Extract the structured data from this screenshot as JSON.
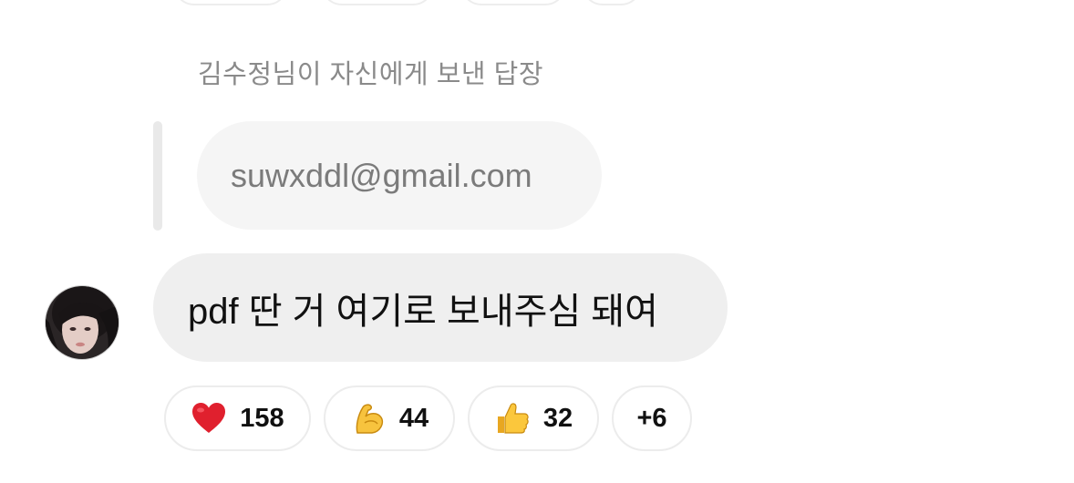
{
  "reply": {
    "header": "김수정님이 자신에게 보낸 답장",
    "quoted_text": "suwxddl@gmail.com"
  },
  "message": {
    "text": "pdf 딴 거 여기로 보내주심 돼여"
  },
  "reactions": [
    {
      "icon": "heart-icon",
      "count": "158"
    },
    {
      "icon": "flexed-biceps-icon",
      "count": "44"
    },
    {
      "icon": "thumbs-up-icon",
      "count": "32"
    },
    {
      "more": "+6"
    }
  ]
}
